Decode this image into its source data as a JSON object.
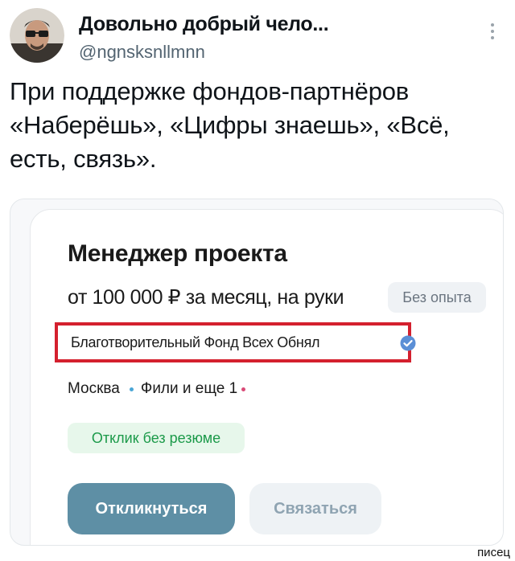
{
  "tweet": {
    "author_name": "Довольно добрый чело...",
    "author_handle": "@ngnsksnllmnn",
    "avatar_icon": "avatar-photo-icon",
    "more_icon": "more-dots-icon",
    "text": "При поддержке фондов-партнёров «Наберёшь», «Цифры знаешь», «Всё, есть, связь»."
  },
  "vacancy": {
    "title": "Менеджер проекта",
    "salary": "от 100 000 ₽ за месяц, на руки",
    "experience_badge": "Без опыта",
    "company": "Благотворительный Фонд Всех Обнял",
    "verified_icon": "verified-check-icon",
    "location_city": "Москва",
    "location_metro": "Фили и еще 1",
    "no_resume_badge": "Отклик без резюме",
    "respond_button": "Откликнуться",
    "contact_button": "Связаться"
  },
  "colors": {
    "highlight_border": "#d4202e",
    "respond_button_bg": "#5e8fa5",
    "no_resume_green": "#1c9a4a",
    "metro_dot_blue": "#4aa6d6",
    "metro_dot_pink": "#d94a77"
  },
  "watermark": "писец"
}
